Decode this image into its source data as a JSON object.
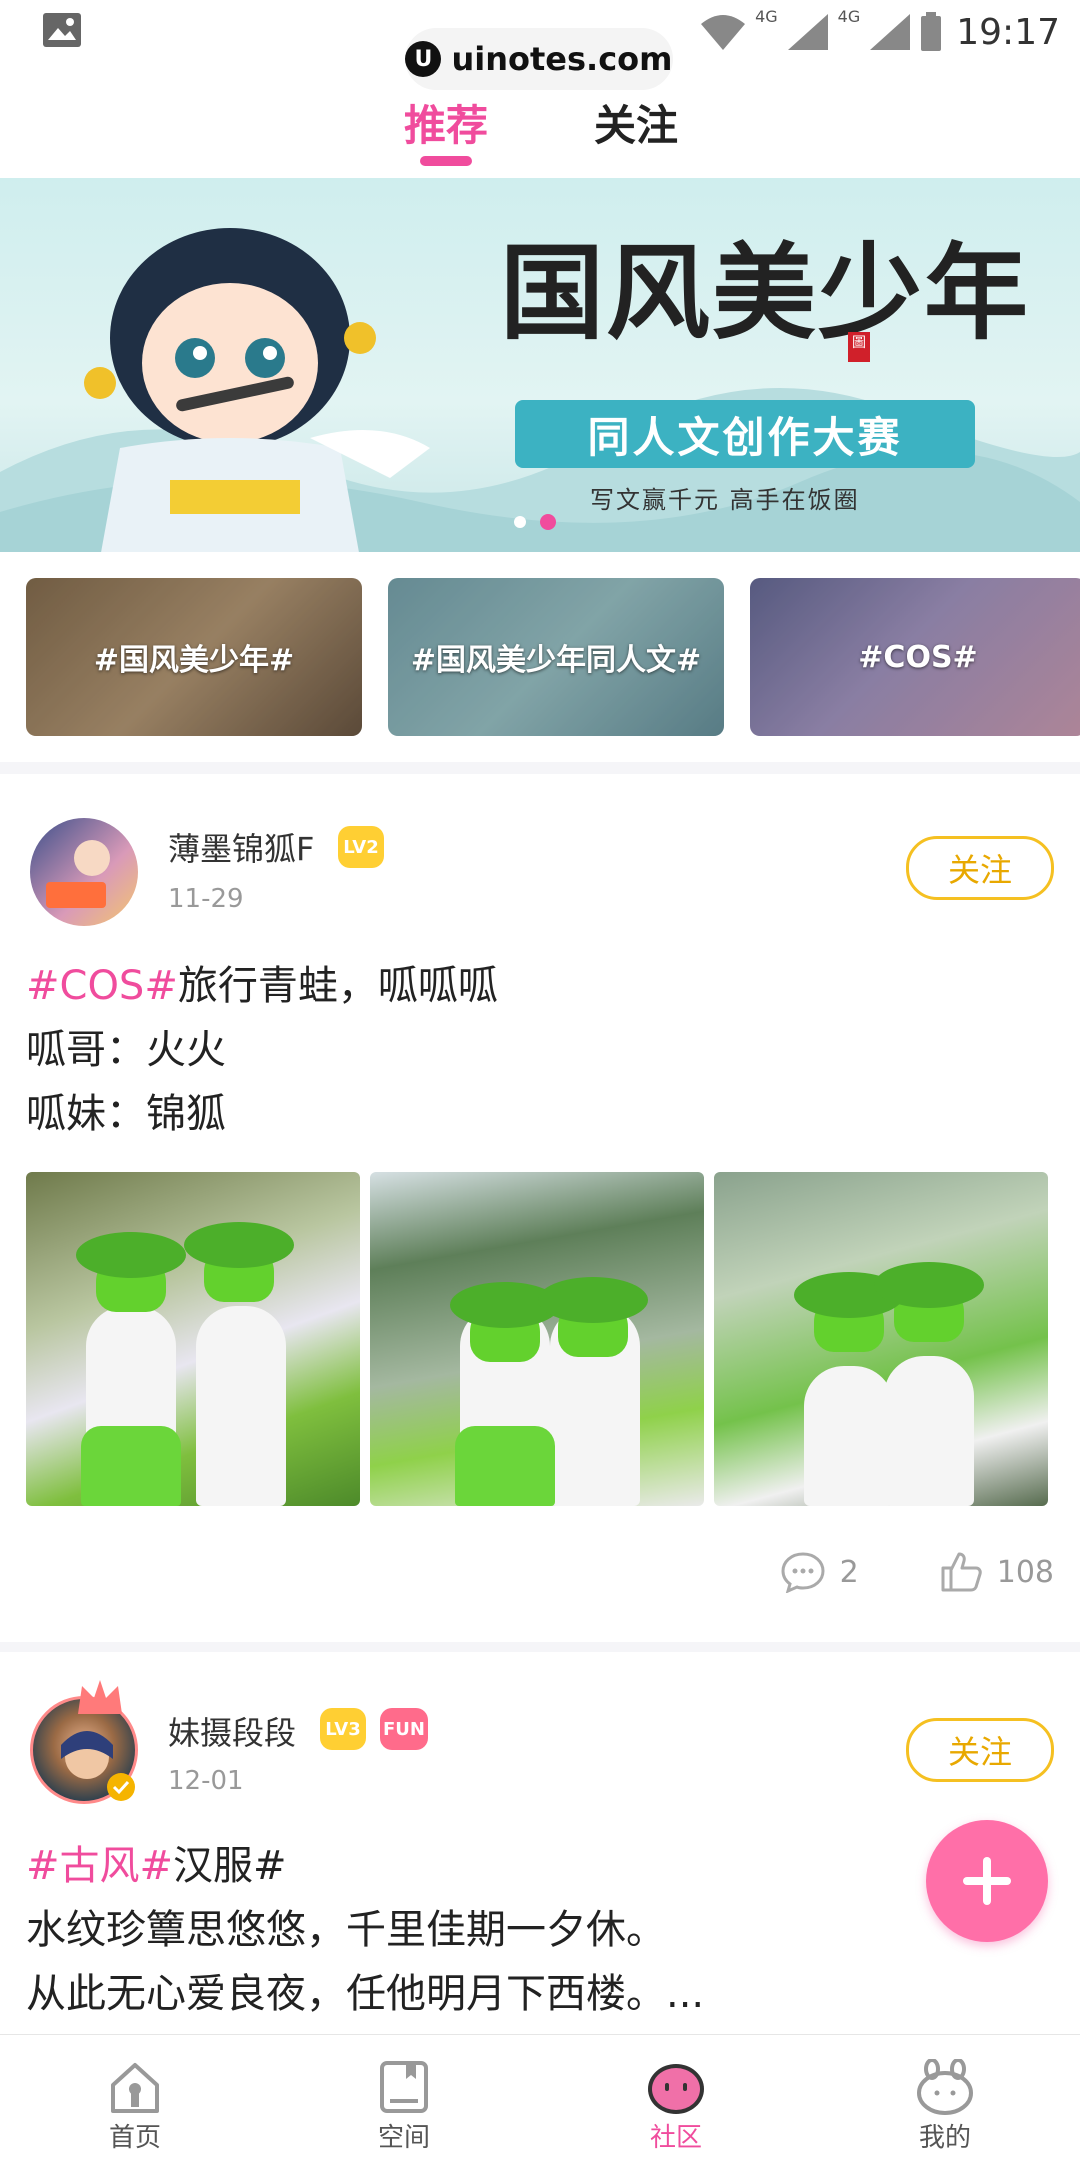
{
  "status_bar": {
    "time": "19:17",
    "network_1": "4G",
    "network_2": "4G"
  },
  "watermark": {
    "text": "uinotes.com",
    "logo": "U"
  },
  "top_tabs": [
    {
      "label": "推荐",
      "active": true
    },
    {
      "label": "关注",
      "active": false
    }
  ],
  "banner": {
    "title": "国风美少年",
    "seal": "圖",
    "ribbon": "同人文创作大赛",
    "subtitle": "写文赢千元   高手在饭圈",
    "page_count": 2,
    "active_index": 1
  },
  "topics": [
    {
      "label": "#国风美少年#"
    },
    {
      "label": "#国风美少年同人文#"
    },
    {
      "label": "#COS#"
    }
  ],
  "posts": [
    {
      "username": "薄墨锦狐F",
      "level": "LV2",
      "date": "11-29",
      "follow_label": "关注",
      "tag": "#COS#",
      "lines": [
        "旅行青蛙，呱呱呱",
        "呱哥：火火",
        "呱妹：锦狐"
      ],
      "comments": "2",
      "likes": "108"
    },
    {
      "username": "妹摄段段",
      "level": "LV3",
      "extra_badge": "FUN",
      "date": "12-01",
      "follow_label": "关注",
      "tag": "#古风#",
      "tag_rest": "汉服#",
      "lines": [
        "水纹珍簟思悠悠，千里佳期一夕休。",
        "从此无心爱良夜，任他明月下西楼。..."
      ]
    }
  ],
  "bottom_nav": [
    {
      "label": "首页",
      "icon": "home-icon",
      "active": false
    },
    {
      "label": "空间",
      "icon": "book-icon",
      "active": false
    },
    {
      "label": "社区",
      "icon": "community-icon",
      "active": true
    },
    {
      "label": "我的",
      "icon": "profile-icon",
      "active": false
    }
  ],
  "colors": {
    "accent": "#f04c9d",
    "follow": "#e8a800",
    "fab": "#ff6fa8"
  }
}
